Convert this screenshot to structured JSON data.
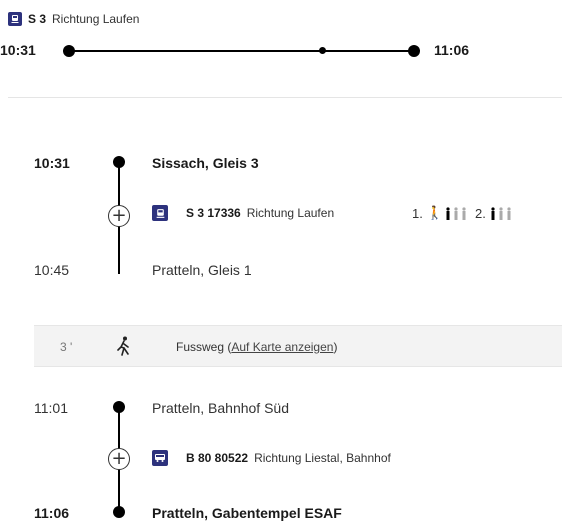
{
  "summary": {
    "line": "S 3",
    "direction": "Richtung Laufen",
    "dep_time": "10:31",
    "arr_time": "11:06"
  },
  "legs": [
    {
      "dep_time": "10:31",
      "dep_stop": "Sissach, Gleis 3",
      "line": "S 3 17336",
      "direction": "Richtung Laufen",
      "class1": "1.",
      "class2": "2.",
      "arr_time": "10:45",
      "arr_stop": "Pratteln, Gleis 1"
    },
    {
      "dep_time": "11:01",
      "dep_stop": "Pratteln, Bahnhof Süd",
      "line": "B 80 80522",
      "direction": "Richtung Liestal, Bahnhof",
      "arr_time": "11:06",
      "arr_stop": "Pratteln, Gabentempel ESAF"
    }
  ],
  "walk": {
    "minutes": "3 '",
    "label": "Fussweg (",
    "link": "Auf Karte anzeigen",
    "close": ")"
  },
  "icons": {
    "train": "train-icon",
    "bus": "bus-icon",
    "walk": "walking-person-icon",
    "occupancy": "occupancy-icon",
    "expand": "plus-icon"
  },
  "colors": {
    "transport_blue": "#2d327d",
    "walk_bg": "#f3f3f3"
  }
}
